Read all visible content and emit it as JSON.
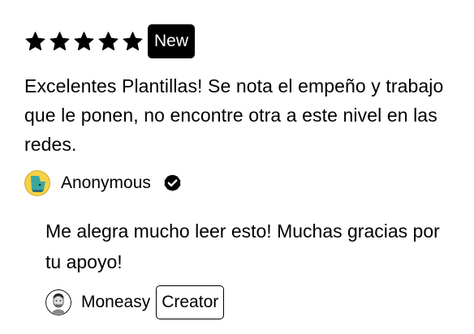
{
  "review": {
    "rating": 5,
    "max_rating": 5,
    "badge": "New",
    "text": "Excelentes Plantillas! Se nota el empeño y trabajo que le ponen, no encontre otra a este nivel en las redes.",
    "author": {
      "name": "Anonymous",
      "avatar_icon": "anonymous-avatar-icon",
      "verified_icon": "verified-check-icon"
    }
  },
  "reply": {
    "text": "Me alegra mucho leer esto! Muchas gracias por tu apoyo!",
    "author": {
      "name": "Moneasy",
      "badge": "Creator",
      "avatar_icon": "creator-avatar-icon"
    }
  },
  "colors": {
    "text": "#000000",
    "background": "#ffffff",
    "avatar_bg": "#f5d246",
    "avatar_accent": "#3aa7a0"
  }
}
